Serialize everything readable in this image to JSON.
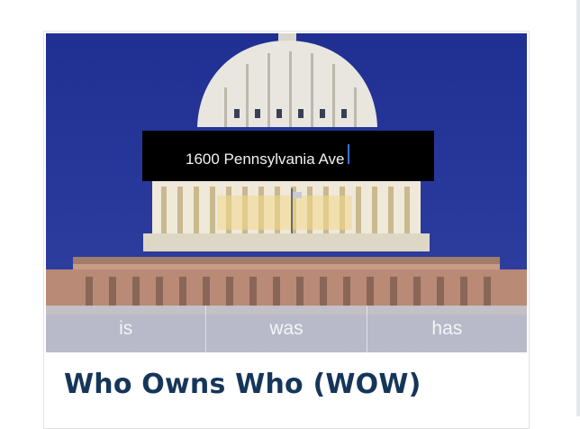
{
  "card": {
    "title": "Who Owns Who (WOW)",
    "image_subject": "US Capitol dome"
  },
  "search": {
    "value": "1600 Pennsylvania Ave"
  },
  "suggestions": [
    "is",
    "was",
    "has"
  ],
  "colors": {
    "title": "#15365a",
    "sky": "#22329a",
    "input_background": "#000000",
    "caret": "#3e6fd6",
    "suggestion_bar": "#c4c4cc"
  }
}
